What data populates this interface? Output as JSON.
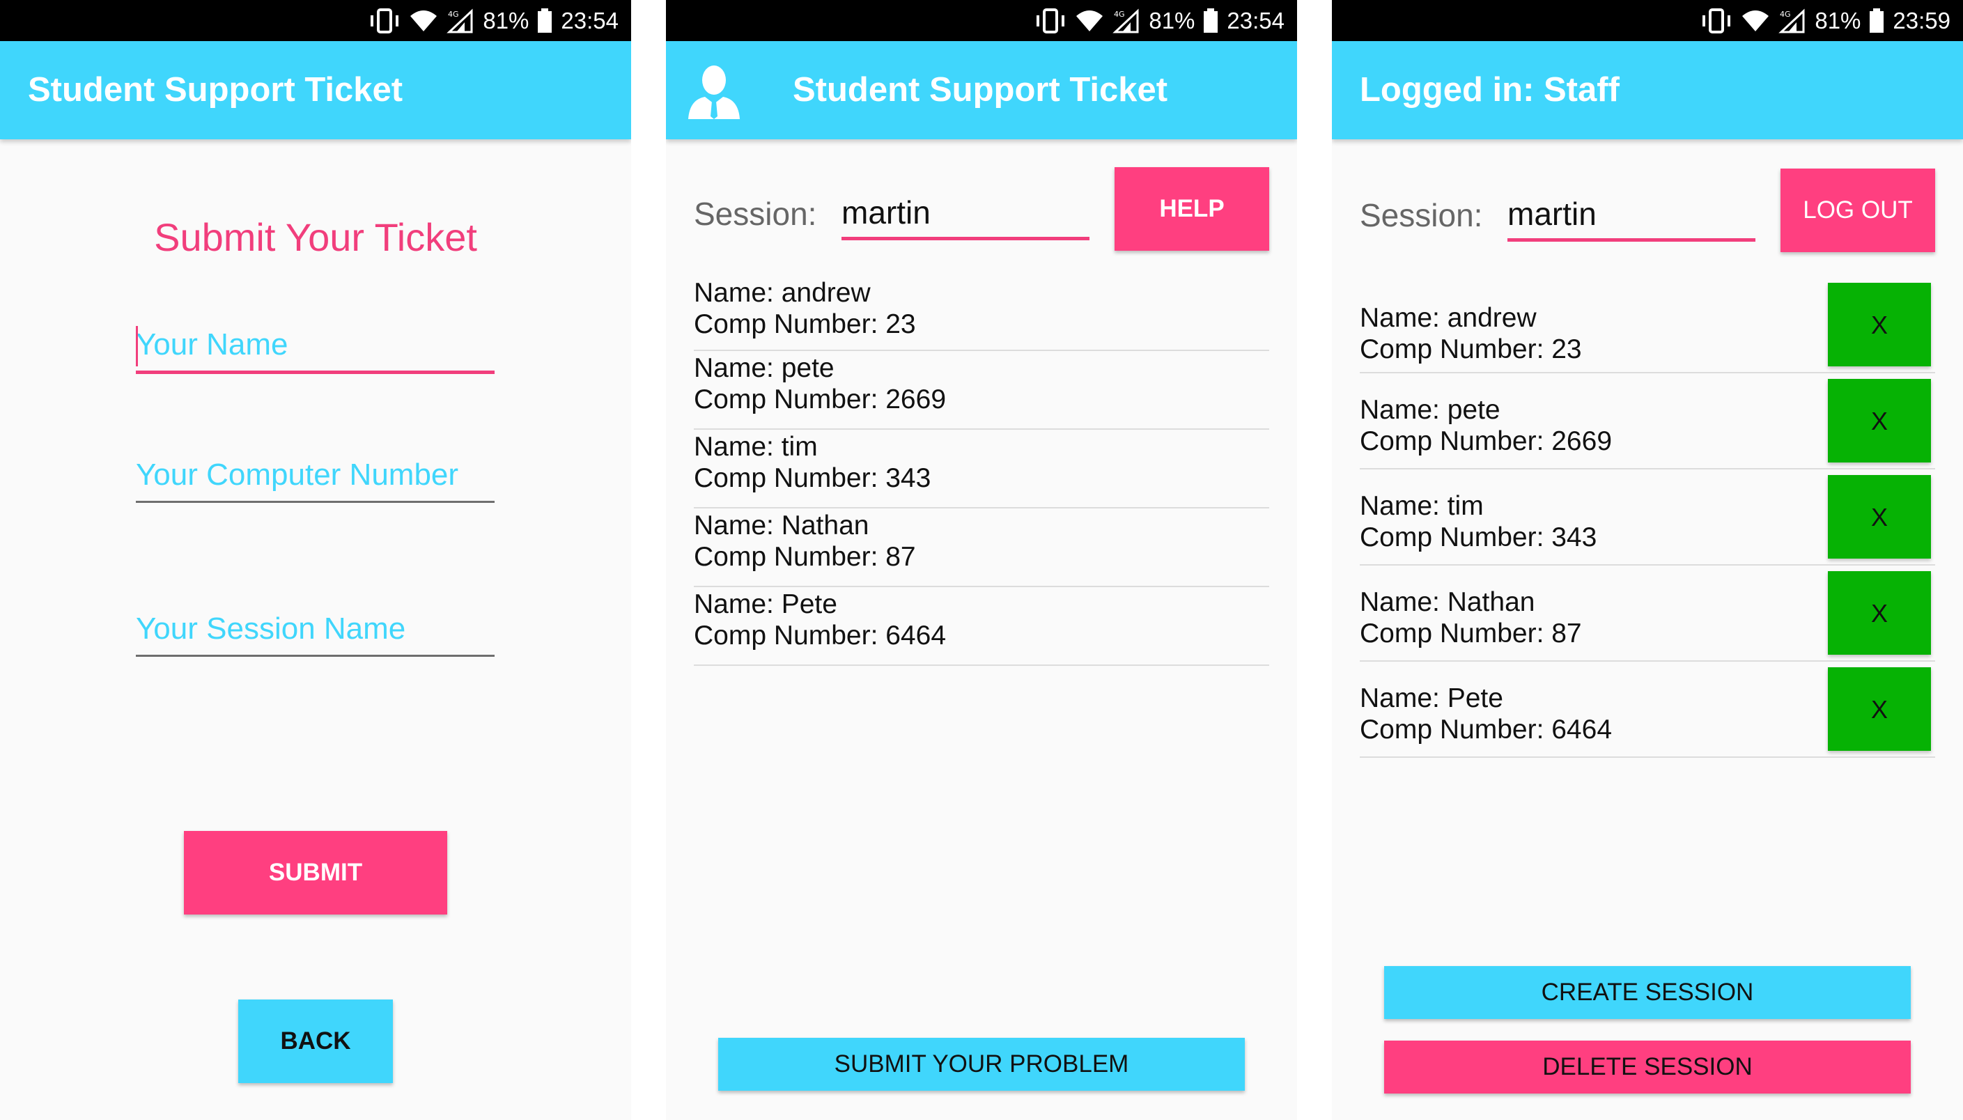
{
  "screens": [
    {
      "status": {
        "battery": "81%",
        "time": "23:54"
      },
      "appbar": {
        "title": "Student Support Ticket"
      },
      "form": {
        "heading": "Submit Your Ticket",
        "name_placeholder": "Your Name",
        "computer_placeholder": "Your Computer Number",
        "session_placeholder": "Your Session Name"
      },
      "buttons": {
        "submit": "SUBMIT",
        "back": "BACK"
      }
    },
    {
      "status": {
        "battery": "81%",
        "time": "23:54"
      },
      "appbar": {
        "title": "Student Support Ticket",
        "icon": "user-avatar-icon"
      },
      "session": {
        "label": "Session:",
        "value": "martin"
      },
      "buttons": {
        "help": "HELP",
        "submit_problem": "SUBMIT YOUR PROBLEM"
      },
      "tickets": [
        {
          "name": "Name:  andrew",
          "comp": "Comp Number: 23"
        },
        {
          "name": "Name:  pete",
          "comp": "Comp Number: 2669"
        },
        {
          "name": "Name:  tim",
          "comp": "Comp Number: 343"
        },
        {
          "name": "Name:  Nathan",
          "comp": "Comp Number: 87"
        },
        {
          "name": "Name:  Pete",
          "comp": "Comp Number: 6464"
        }
      ]
    },
    {
      "status": {
        "battery": "81%",
        "time": "23:59"
      },
      "appbar": {
        "title": "Logged in: Staff"
      },
      "session": {
        "label": "Session:",
        "value": "martin"
      },
      "buttons": {
        "logout": "LOG OUT",
        "create": "CREATE SESSION",
        "delete": "DELETE SESSION",
        "remove": "X"
      },
      "tickets": [
        {
          "name": "Name:  andrew",
          "comp": "Comp Number: 23"
        },
        {
          "name": "Name:  pete",
          "comp": "Comp Number: 2669"
        },
        {
          "name": "Name:  tim",
          "comp": "Comp Number: 343"
        },
        {
          "name": "Name:  Nathan",
          "comp": "Comp Number: 87"
        },
        {
          "name": "Name:  Pete",
          "comp": "Comp Number: 6464"
        }
      ]
    }
  ],
  "colors": {
    "accent": "#40d6fc",
    "pink": "#ff3f80",
    "green": "#06b204"
  }
}
